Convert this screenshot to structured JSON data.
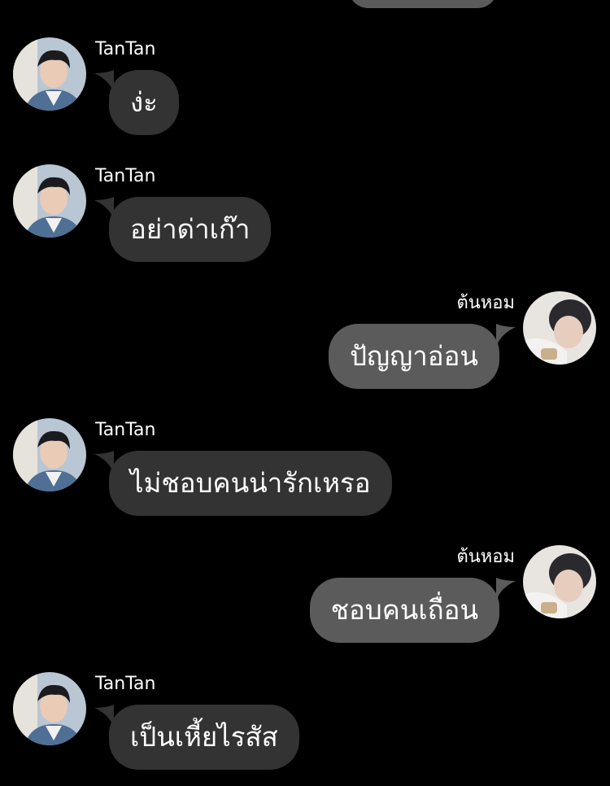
{
  "colors": {
    "background": "#000000",
    "incoming_bubble": "#333333",
    "outgoing_bubble": "#5b5b5b",
    "text": "#ffffff"
  },
  "messages": [
    {
      "direction": "incoming",
      "sender": "TanTan",
      "text": "ง่ะ",
      "avatar": "tantan-avatar"
    },
    {
      "direction": "incoming",
      "sender": "TanTan",
      "text": "อย่าด่าเก๊า",
      "avatar": "tantan-avatar"
    },
    {
      "direction": "outgoing",
      "sender": "ต้นหอม",
      "text": "ปัญญาอ่อน",
      "avatar": "tonhom-avatar"
    },
    {
      "direction": "incoming",
      "sender": "TanTan",
      "text": "ไม่ชอบคนน่ารักเหรอ",
      "avatar": "tantan-avatar"
    },
    {
      "direction": "outgoing",
      "sender": "ต้นหอม",
      "text": "ชอบคนเถื่อน",
      "avatar": "tonhom-avatar"
    },
    {
      "direction": "incoming",
      "sender": "TanTan",
      "text": "เป็นเหี้ยไรสัส",
      "avatar": "tantan-avatar"
    }
  ]
}
